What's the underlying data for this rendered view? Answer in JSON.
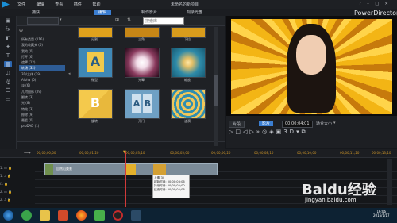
{
  "app": {
    "window_title": "未命名的新项目",
    "brand": "PowerDirector",
    "menu": [
      "文件",
      "编辑",
      "查看",
      "插件",
      "帮助"
    ]
  },
  "modes": [
    {
      "label": "捕获",
      "active": false
    },
    {
      "label": "编辑",
      "active": true
    },
    {
      "label": "制作影片",
      "active": false
    },
    {
      "label": "刻录光盘",
      "active": false
    }
  ],
  "library": {
    "dropdown": "",
    "search_placeholder": "搜索库",
    "categories": [
      "所有类型 (116)",
      "我的收藏夹 (0)",
      "我的 (0)",
      "打开 (6)",
      "遮罩 (12)",
      "转场 (32)",
      "3D/立体 (29)",
      "Alpha (0)",
      "淡 (6)",
      "几何图形 (29)",
      "翻转 (3)",
      "光 (8)",
      "特效 (3)",
      "擦除 (9)",
      "最爱 (0)",
      "proDAD (1)"
    ],
    "selected_category": "转场 (32)",
    "thumbnails": [
      {
        "label": "分割"
      },
      {
        "label": "三角"
      },
      {
        "label": "下拉"
      },
      {
        "label": "微型"
      },
      {
        "label": "光晕"
      },
      {
        "label": "缩放"
      },
      {
        "label": "旋转"
      },
      {
        "label": "开门"
      },
      {
        "label": "涟漪"
      }
    ]
  },
  "preview": {
    "mode_left": "片段",
    "mode_right": "影片",
    "timecode": "00;00;04;01",
    "zoom": "适合大小"
  },
  "timeline": {
    "ruler": [
      "00;00;00;00",
      "00;00;01;20",
      "00;00;03;10",
      "00;00;05;00",
      "00;00;06;20",
      "00;00;08;10",
      "00;00;10;00",
      "00;00;11;20",
      "00;00;13;10",
      "00;00;15;00"
    ],
    "tracks": [
      {
        "id": "1.",
        "type": "video"
      },
      {
        "id": "1.",
        "type": "audio"
      },
      {
        "id": "fx",
        "type": "effect"
      },
      {
        "id": "2.",
        "type": "video"
      },
      {
        "id": "2.",
        "type": "audio"
      }
    ],
    "clip_label": "自然山美景",
    "tooltip": {
      "title": "入像(3)",
      "lines": [
        "起始时间: 00;00;03;06",
        "持续时间: 00;00;02;00",
        "结束时间: 00;00;05;06"
      ]
    }
  },
  "taskbar": {
    "time": "16:06",
    "date": "2016/1/17"
  },
  "watermark": {
    "logo": "Baidu经验",
    "url": "jingyan.baidu.com"
  },
  "colors": {
    "accent": "#3b7ed1",
    "playhead": "#d13a3a",
    "ruler": "#cc9428"
  }
}
